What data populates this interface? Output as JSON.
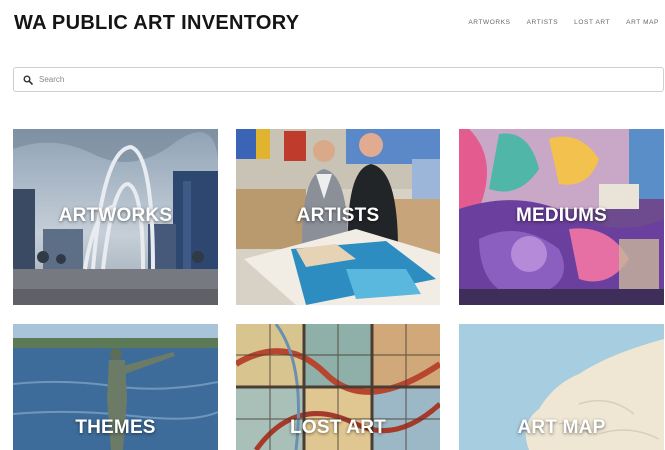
{
  "header": {
    "title": "WA PUBLIC ART INVENTORY",
    "nav": [
      "ARTWORKS",
      "ARTISTS",
      "LOST ART",
      "ART MAP"
    ]
  },
  "search": {
    "placeholder": "Search",
    "icon": "search-icon"
  },
  "tiles": [
    {
      "label": "ARTWORKS"
    },
    {
      "label": "ARTISTS"
    },
    {
      "label": "MEDIUMS"
    },
    {
      "label": "THEMES"
    },
    {
      "label": "LOST ART"
    },
    {
      "label": "ART MAP"
    }
  ]
}
